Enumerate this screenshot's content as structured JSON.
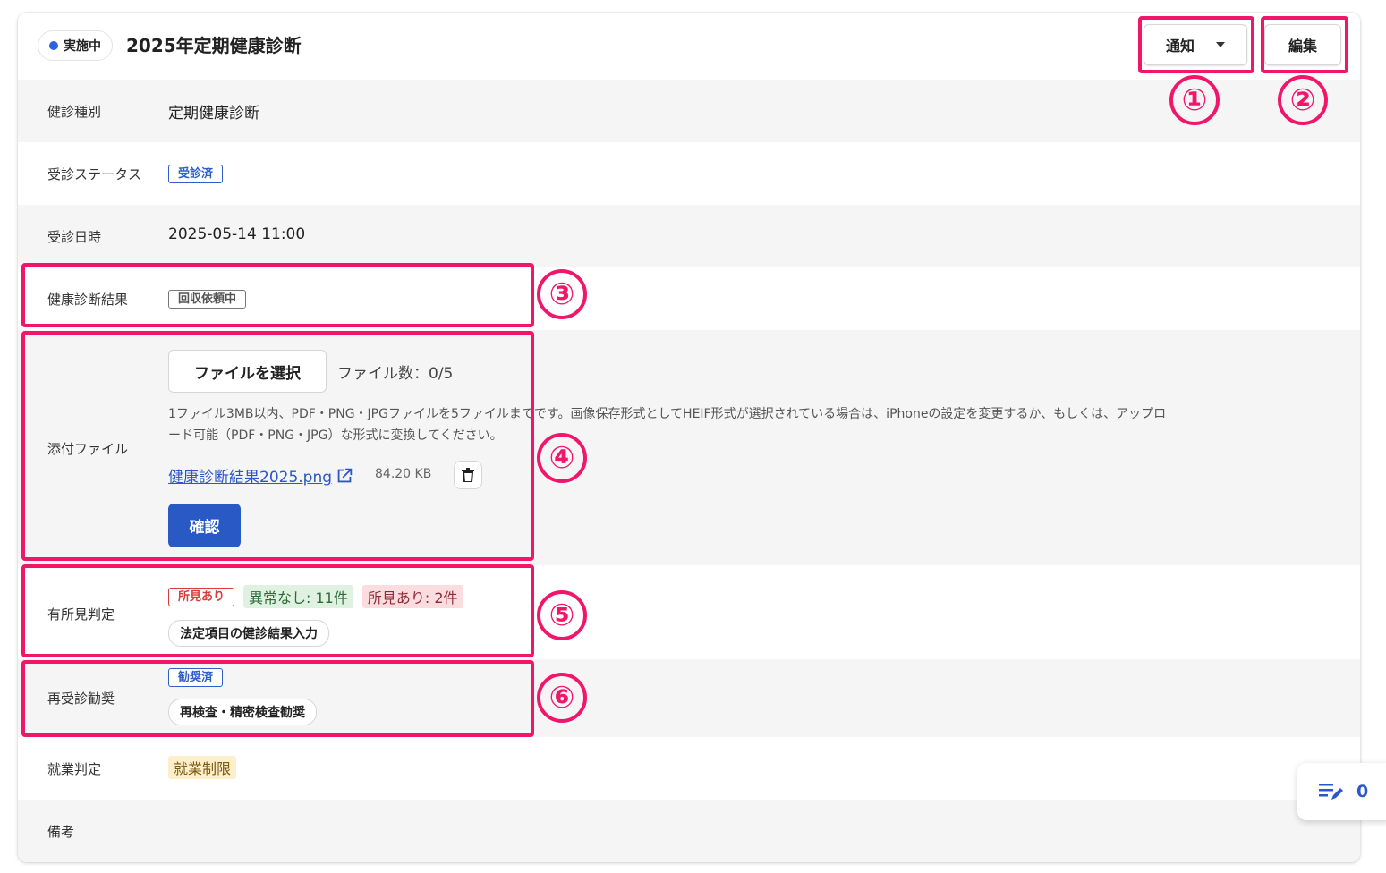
{
  "header": {
    "status_badge": "実施中",
    "title": "2025年定期健康診断",
    "notify_label": "通知",
    "edit_label": "編集"
  },
  "rows": {
    "checkup_type": {
      "label": "健診種別",
      "value": "定期健康診断"
    },
    "exam_status": {
      "label": "受診ステータス",
      "tag": "受診済"
    },
    "exam_datetime": {
      "label": "受診日時",
      "value": "2025-05-14 11:00"
    },
    "result": {
      "label": "健康診断結果",
      "tag": "回収依頼中"
    },
    "attachment": {
      "label": "添付ファイル",
      "select_button": "ファイルを選択",
      "file_count": "ファイル数：0/5",
      "help_line1": "1ファイル3MB以内、PDF・PNG・JPGファイルを5ファイルまでです。画像保存形式としてHEIF形式が選択されている場合は、iPhoneの設定を変更するか、もしくは、アップロ",
      "help_line2": "ード可能（PDF・PNG・JPG）な形式に変換してください。",
      "file_name": "健康診断結果2025.png",
      "file_size": "84.20 KB",
      "confirm_button": "確認"
    },
    "findings": {
      "label": "有所見判定",
      "tag": "所見あり",
      "normal_chip": "異常なし: 11件",
      "finding_chip": "所見あり: 2件",
      "input_button": "法定項目の健診結果入力"
    },
    "recheck": {
      "label": "再受診勧奨",
      "tag": "勧奨済",
      "button": "再検査・精密検査勧奨"
    },
    "work_judgment": {
      "label": "就業判定",
      "chip": "就業制限"
    },
    "remarks": {
      "label": "備考"
    }
  },
  "annotations": [
    "①",
    "②",
    "③",
    "④",
    "⑤",
    "⑥"
  ],
  "floating": {
    "count": "0"
  },
  "colors": {
    "annotation": "#f0176a",
    "primary": "#2859c5",
    "status_dot": "#2b63e0"
  }
}
